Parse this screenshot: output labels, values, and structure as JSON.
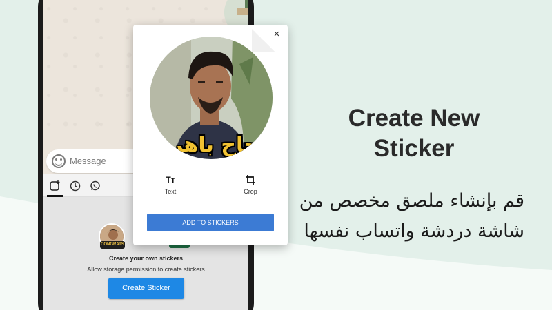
{
  "colors": {
    "background": "#e3f0ea",
    "accent_blue": "#1e88e5",
    "dialog_button": "#3c7bd4",
    "caption_gold": "#f1c232"
  },
  "chat": {
    "message_placeholder": "Message",
    "tabs": [
      {
        "icon": "sticker-add-icon",
        "active": true
      },
      {
        "icon": "clock-icon",
        "active": false
      },
      {
        "icon": "whatsapp-icon",
        "active": false
      }
    ]
  },
  "sticker_panel": {
    "sample_badge": "CONGRATS",
    "title": "Create your own stickers",
    "subtitle": "Allow storage permission to create stickers",
    "create_button": "Create Sticker"
  },
  "dialog": {
    "close_icon": "×",
    "photo_caption": "نجاح باهر",
    "tools": [
      {
        "icon": "text-icon",
        "glyph": "Tт",
        "label": "Text"
      },
      {
        "icon": "crop-icon",
        "glyph": "⌗",
        "label": "Crop"
      }
    ],
    "add_button": "ADD TO STICKERS"
  },
  "promo": {
    "headline_line1": "Create New",
    "headline_line2": "Sticker",
    "arabic_line1": "قم بإنشاء ملصق مخصص من",
    "arabic_line2": "شاشة دردشة  واتساب نفسها"
  }
}
